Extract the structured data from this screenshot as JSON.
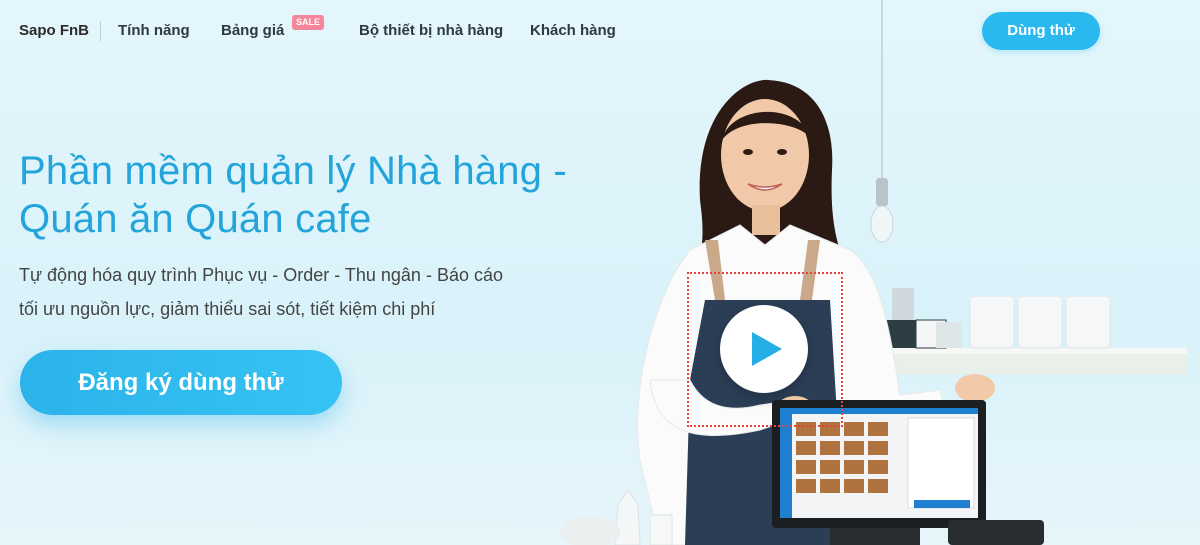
{
  "header": {
    "brand": "Sapo FnB",
    "nav": [
      {
        "label": "Tính năng"
      },
      {
        "label": "Bảng giá",
        "badge": "SALE"
      },
      {
        "label": "Bộ thiết bị nhà hàng"
      },
      {
        "label": "Khách hàng"
      }
    ],
    "try_button": "Dùng thử"
  },
  "hero": {
    "title_line1": "Phần mềm quản lý Nhà hàng -",
    "title_line2": "Quán ăn Quán cafe",
    "subtitle_line1": "Tự động hóa quy trình Phục vụ - Order - Thu ngân - Báo cáo",
    "subtitle_line2": "tối ưu nguồn lực, giảm thiểu sai sót, tiết kiệm chi phí",
    "cta_button": "Đăng ký dùng thử"
  },
  "media": {
    "illustration": "woman-holding-pos-tablet-illustration",
    "play_icon": "play-icon"
  },
  "colors": {
    "accent": "#29b9ef",
    "title": "#23a4da",
    "sale_badge": "#f4879b",
    "background": "#e0f5fa"
  }
}
